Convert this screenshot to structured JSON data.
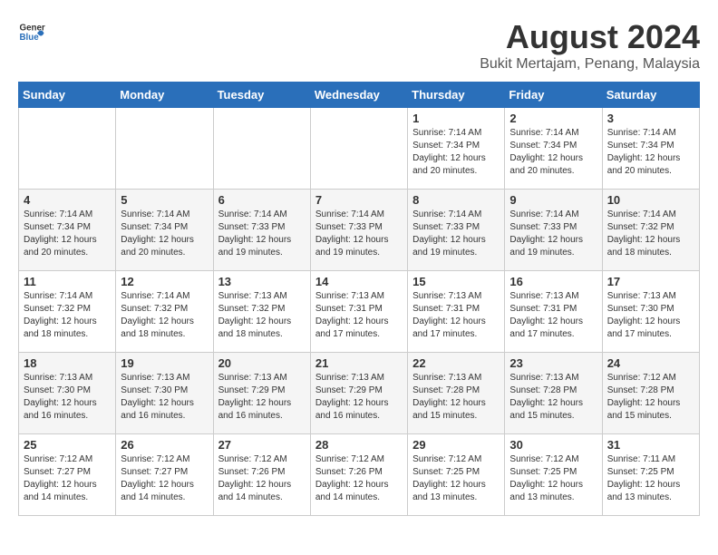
{
  "header": {
    "logo_general": "General",
    "logo_blue": "Blue",
    "title": "August 2024",
    "subtitle": "Bukit Mertajam, Penang, Malaysia"
  },
  "days_of_week": [
    "Sunday",
    "Monday",
    "Tuesday",
    "Wednesday",
    "Thursday",
    "Friday",
    "Saturday"
  ],
  "weeks": [
    [
      {
        "day": "",
        "info": ""
      },
      {
        "day": "",
        "info": ""
      },
      {
        "day": "",
        "info": ""
      },
      {
        "day": "",
        "info": ""
      },
      {
        "day": "1",
        "info": "Sunrise: 7:14 AM\nSunset: 7:34 PM\nDaylight: 12 hours\nand 20 minutes."
      },
      {
        "day": "2",
        "info": "Sunrise: 7:14 AM\nSunset: 7:34 PM\nDaylight: 12 hours\nand 20 minutes."
      },
      {
        "day": "3",
        "info": "Sunrise: 7:14 AM\nSunset: 7:34 PM\nDaylight: 12 hours\nand 20 minutes."
      }
    ],
    [
      {
        "day": "4",
        "info": "Sunrise: 7:14 AM\nSunset: 7:34 PM\nDaylight: 12 hours\nand 20 minutes."
      },
      {
        "day": "5",
        "info": "Sunrise: 7:14 AM\nSunset: 7:34 PM\nDaylight: 12 hours\nand 20 minutes."
      },
      {
        "day": "6",
        "info": "Sunrise: 7:14 AM\nSunset: 7:33 PM\nDaylight: 12 hours\nand 19 minutes."
      },
      {
        "day": "7",
        "info": "Sunrise: 7:14 AM\nSunset: 7:33 PM\nDaylight: 12 hours\nand 19 minutes."
      },
      {
        "day": "8",
        "info": "Sunrise: 7:14 AM\nSunset: 7:33 PM\nDaylight: 12 hours\nand 19 minutes."
      },
      {
        "day": "9",
        "info": "Sunrise: 7:14 AM\nSunset: 7:33 PM\nDaylight: 12 hours\nand 19 minutes."
      },
      {
        "day": "10",
        "info": "Sunrise: 7:14 AM\nSunset: 7:32 PM\nDaylight: 12 hours\nand 18 minutes."
      }
    ],
    [
      {
        "day": "11",
        "info": "Sunrise: 7:14 AM\nSunset: 7:32 PM\nDaylight: 12 hours\nand 18 minutes."
      },
      {
        "day": "12",
        "info": "Sunrise: 7:14 AM\nSunset: 7:32 PM\nDaylight: 12 hours\nand 18 minutes."
      },
      {
        "day": "13",
        "info": "Sunrise: 7:13 AM\nSunset: 7:32 PM\nDaylight: 12 hours\nand 18 minutes."
      },
      {
        "day": "14",
        "info": "Sunrise: 7:13 AM\nSunset: 7:31 PM\nDaylight: 12 hours\nand 17 minutes."
      },
      {
        "day": "15",
        "info": "Sunrise: 7:13 AM\nSunset: 7:31 PM\nDaylight: 12 hours\nand 17 minutes."
      },
      {
        "day": "16",
        "info": "Sunrise: 7:13 AM\nSunset: 7:31 PM\nDaylight: 12 hours\nand 17 minutes."
      },
      {
        "day": "17",
        "info": "Sunrise: 7:13 AM\nSunset: 7:30 PM\nDaylight: 12 hours\nand 17 minutes."
      }
    ],
    [
      {
        "day": "18",
        "info": "Sunrise: 7:13 AM\nSunset: 7:30 PM\nDaylight: 12 hours\nand 16 minutes."
      },
      {
        "day": "19",
        "info": "Sunrise: 7:13 AM\nSunset: 7:30 PM\nDaylight: 12 hours\nand 16 minutes."
      },
      {
        "day": "20",
        "info": "Sunrise: 7:13 AM\nSunset: 7:29 PM\nDaylight: 12 hours\nand 16 minutes."
      },
      {
        "day": "21",
        "info": "Sunrise: 7:13 AM\nSunset: 7:29 PM\nDaylight: 12 hours\nand 16 minutes."
      },
      {
        "day": "22",
        "info": "Sunrise: 7:13 AM\nSunset: 7:28 PM\nDaylight: 12 hours\nand 15 minutes."
      },
      {
        "day": "23",
        "info": "Sunrise: 7:13 AM\nSunset: 7:28 PM\nDaylight: 12 hours\nand 15 minutes."
      },
      {
        "day": "24",
        "info": "Sunrise: 7:12 AM\nSunset: 7:28 PM\nDaylight: 12 hours\nand 15 minutes."
      }
    ],
    [
      {
        "day": "25",
        "info": "Sunrise: 7:12 AM\nSunset: 7:27 PM\nDaylight: 12 hours\nand 14 minutes."
      },
      {
        "day": "26",
        "info": "Sunrise: 7:12 AM\nSunset: 7:27 PM\nDaylight: 12 hours\nand 14 minutes."
      },
      {
        "day": "27",
        "info": "Sunrise: 7:12 AM\nSunset: 7:26 PM\nDaylight: 12 hours\nand 14 minutes."
      },
      {
        "day": "28",
        "info": "Sunrise: 7:12 AM\nSunset: 7:26 PM\nDaylight: 12 hours\nand 14 minutes."
      },
      {
        "day": "29",
        "info": "Sunrise: 7:12 AM\nSunset: 7:25 PM\nDaylight: 12 hours\nand 13 minutes."
      },
      {
        "day": "30",
        "info": "Sunrise: 7:12 AM\nSunset: 7:25 PM\nDaylight: 12 hours\nand 13 minutes."
      },
      {
        "day": "31",
        "info": "Sunrise: 7:11 AM\nSunset: 7:25 PM\nDaylight: 12 hours\nand 13 minutes."
      }
    ]
  ]
}
